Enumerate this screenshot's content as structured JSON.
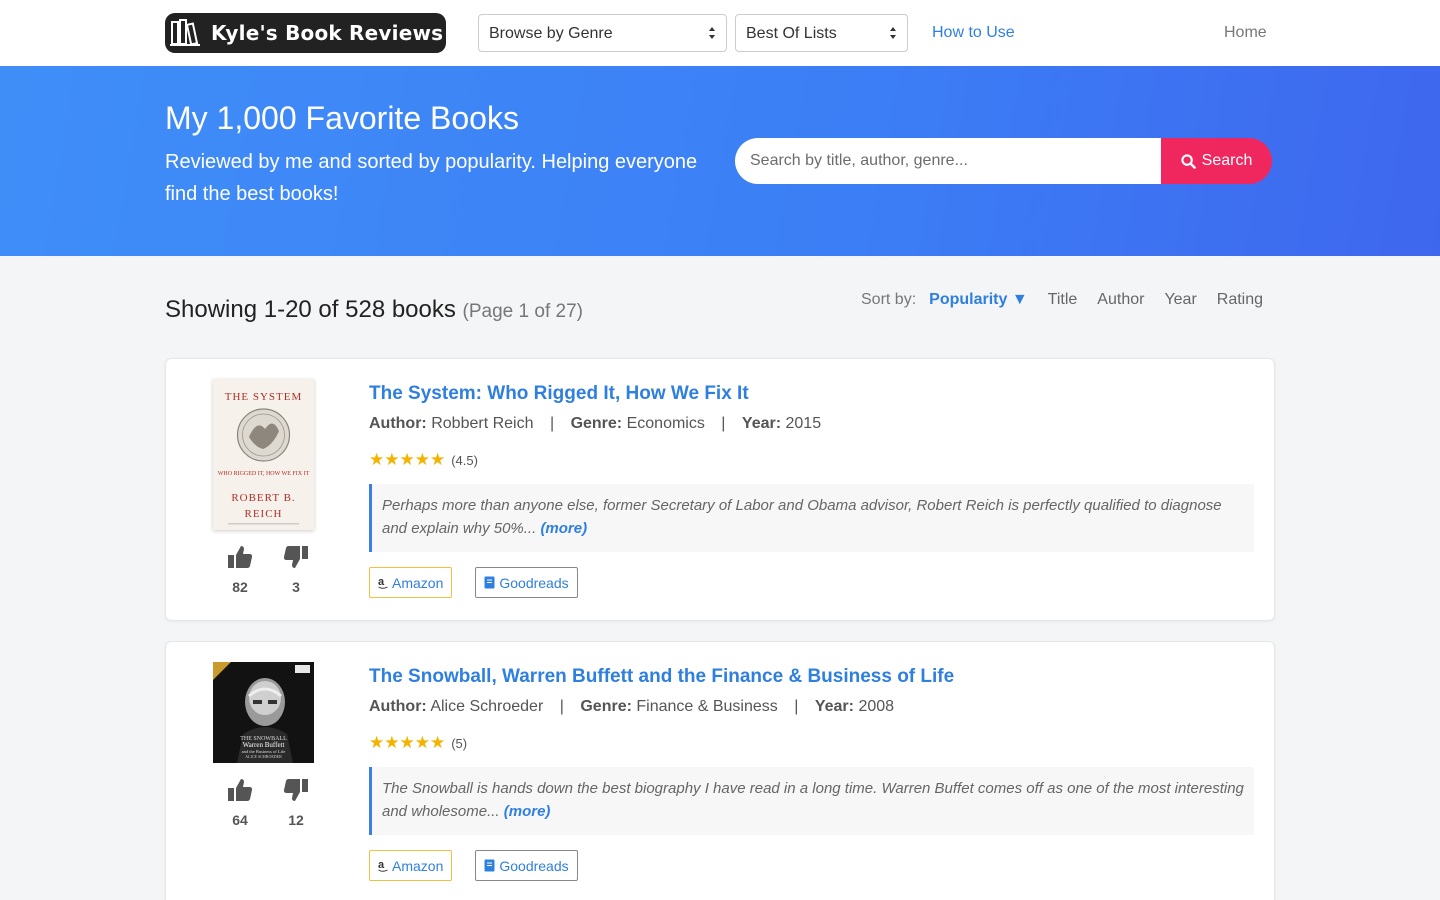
{
  "nav": {
    "logo_text": "Kyle's Book Reviews",
    "genre_select": "Browse by Genre",
    "best_select": "Best Of Lists",
    "how_to_use": "How to Use",
    "home": "Home"
  },
  "hero": {
    "title": "My 1,000 Favorite Books",
    "subtitle": "Reviewed by me and sorted by popularity. Helping everyone find the best books!",
    "search_placeholder": "Search by title, author, genre...",
    "search_button": "Search"
  },
  "results": {
    "showing": "Showing 1-20 of 528 books",
    "page_info": "(Page 1 of 27)",
    "sort_label": "Sort by:",
    "sort_active": "Popularity ▼",
    "sort_options": [
      "Title",
      "Author",
      "Year",
      "Rating"
    ]
  },
  "labels": {
    "author": "Author:",
    "genre": "Genre:",
    "year": "Year:",
    "more": "(more)",
    "amazon": "Amazon",
    "goodreads": "Goodreads",
    "separator": "|"
  },
  "books": [
    {
      "title": "The System: Who Rigged It, How We Fix It",
      "author": "Robbert Reich",
      "genre": "Economics",
      "year": "2015",
      "stars": "★★★★★",
      "rating": "(4.5)",
      "description": "Perhaps more than anyone else, former Secretary of Labor and Obama advisor, Robert Reich is perfectly qualified to diagnose and explain why 50%...",
      "upvotes": "82",
      "downvotes": "3",
      "cover_text": {
        "top": "THE SYSTEM",
        "middle": "WHO RIGGED IT, HOW WE FIX IT",
        "bottom1": "ROBERT B.",
        "bottom2": "REICH"
      }
    },
    {
      "title": "The Snowball, Warren Buffett and the Finance & Business of Life",
      "author": "Alice Schroeder",
      "genre": "Finance & Business",
      "year": "2008",
      "stars": "★★★★★",
      "rating": "(5)",
      "description": "The Snowball is hands down the best biography I have read in a long time. Warren Buffet comes off as one of the most interesting and wholesome...",
      "upvotes": "64",
      "downvotes": "12",
      "cover_text": {
        "top": "THE SNOWBALL",
        "middle": "Warren Buffett",
        "bottom1": "and the Business of Life",
        "bottom2": "ALICE SCHROEDER"
      }
    }
  ],
  "colors": {
    "accent": "#2f7fe0",
    "search_button": "#f0275f",
    "star": "#f3b300"
  },
  "icons": {
    "logo": "books-icon",
    "search": "search-icon",
    "upvote": "thumbs-up-icon",
    "downvote": "thumbs-down-icon",
    "amazon": "amazon-icon",
    "goodreads": "book-icon"
  }
}
